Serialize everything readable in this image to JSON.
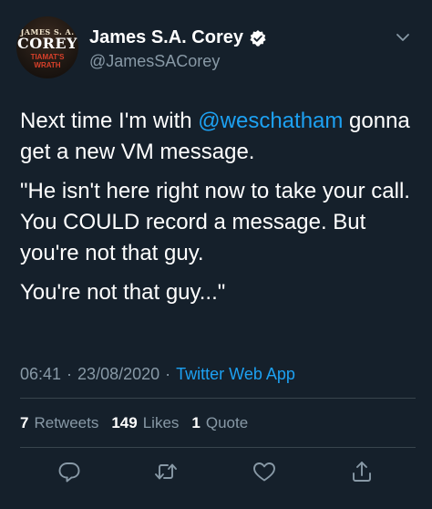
{
  "author": {
    "display_name": "James S.A. Corey",
    "handle": "@JamesSACorey",
    "verified": true,
    "avatar": {
      "top_text": "JAMES S. A.",
      "main_text": "COREY",
      "sub_text_1": "TIAMAT'S",
      "sub_text_2": "WRATH"
    }
  },
  "tweet": {
    "line1_prefix": "Next time I'm with ",
    "mention": "@weschatham",
    "line1_suffix": " gonna get a new VM message.",
    "paragraph2": "\"He isn't here right now to take your call.  You COULD record a message. But you're not that guy.",
    "paragraph3": "You're not that guy...\""
  },
  "meta": {
    "time": "06:41",
    "date": "23/08/2020",
    "separator": "·",
    "app": "Twitter Web App"
  },
  "stats": {
    "retweets_count": "7",
    "retweets_label": "Retweets",
    "likes_count": "149",
    "likes_label": "Likes",
    "quotes_count": "1",
    "quotes_label": "Quote"
  },
  "colors": {
    "background": "#15202b",
    "text": "#ffffff",
    "secondary": "#8899a6",
    "accent": "#1da1f2",
    "divider": "#38444d"
  },
  "icons": [
    "caret-down-icon",
    "verified-badge-icon",
    "reply-icon",
    "retweet-icon",
    "like-icon",
    "share-icon"
  ]
}
